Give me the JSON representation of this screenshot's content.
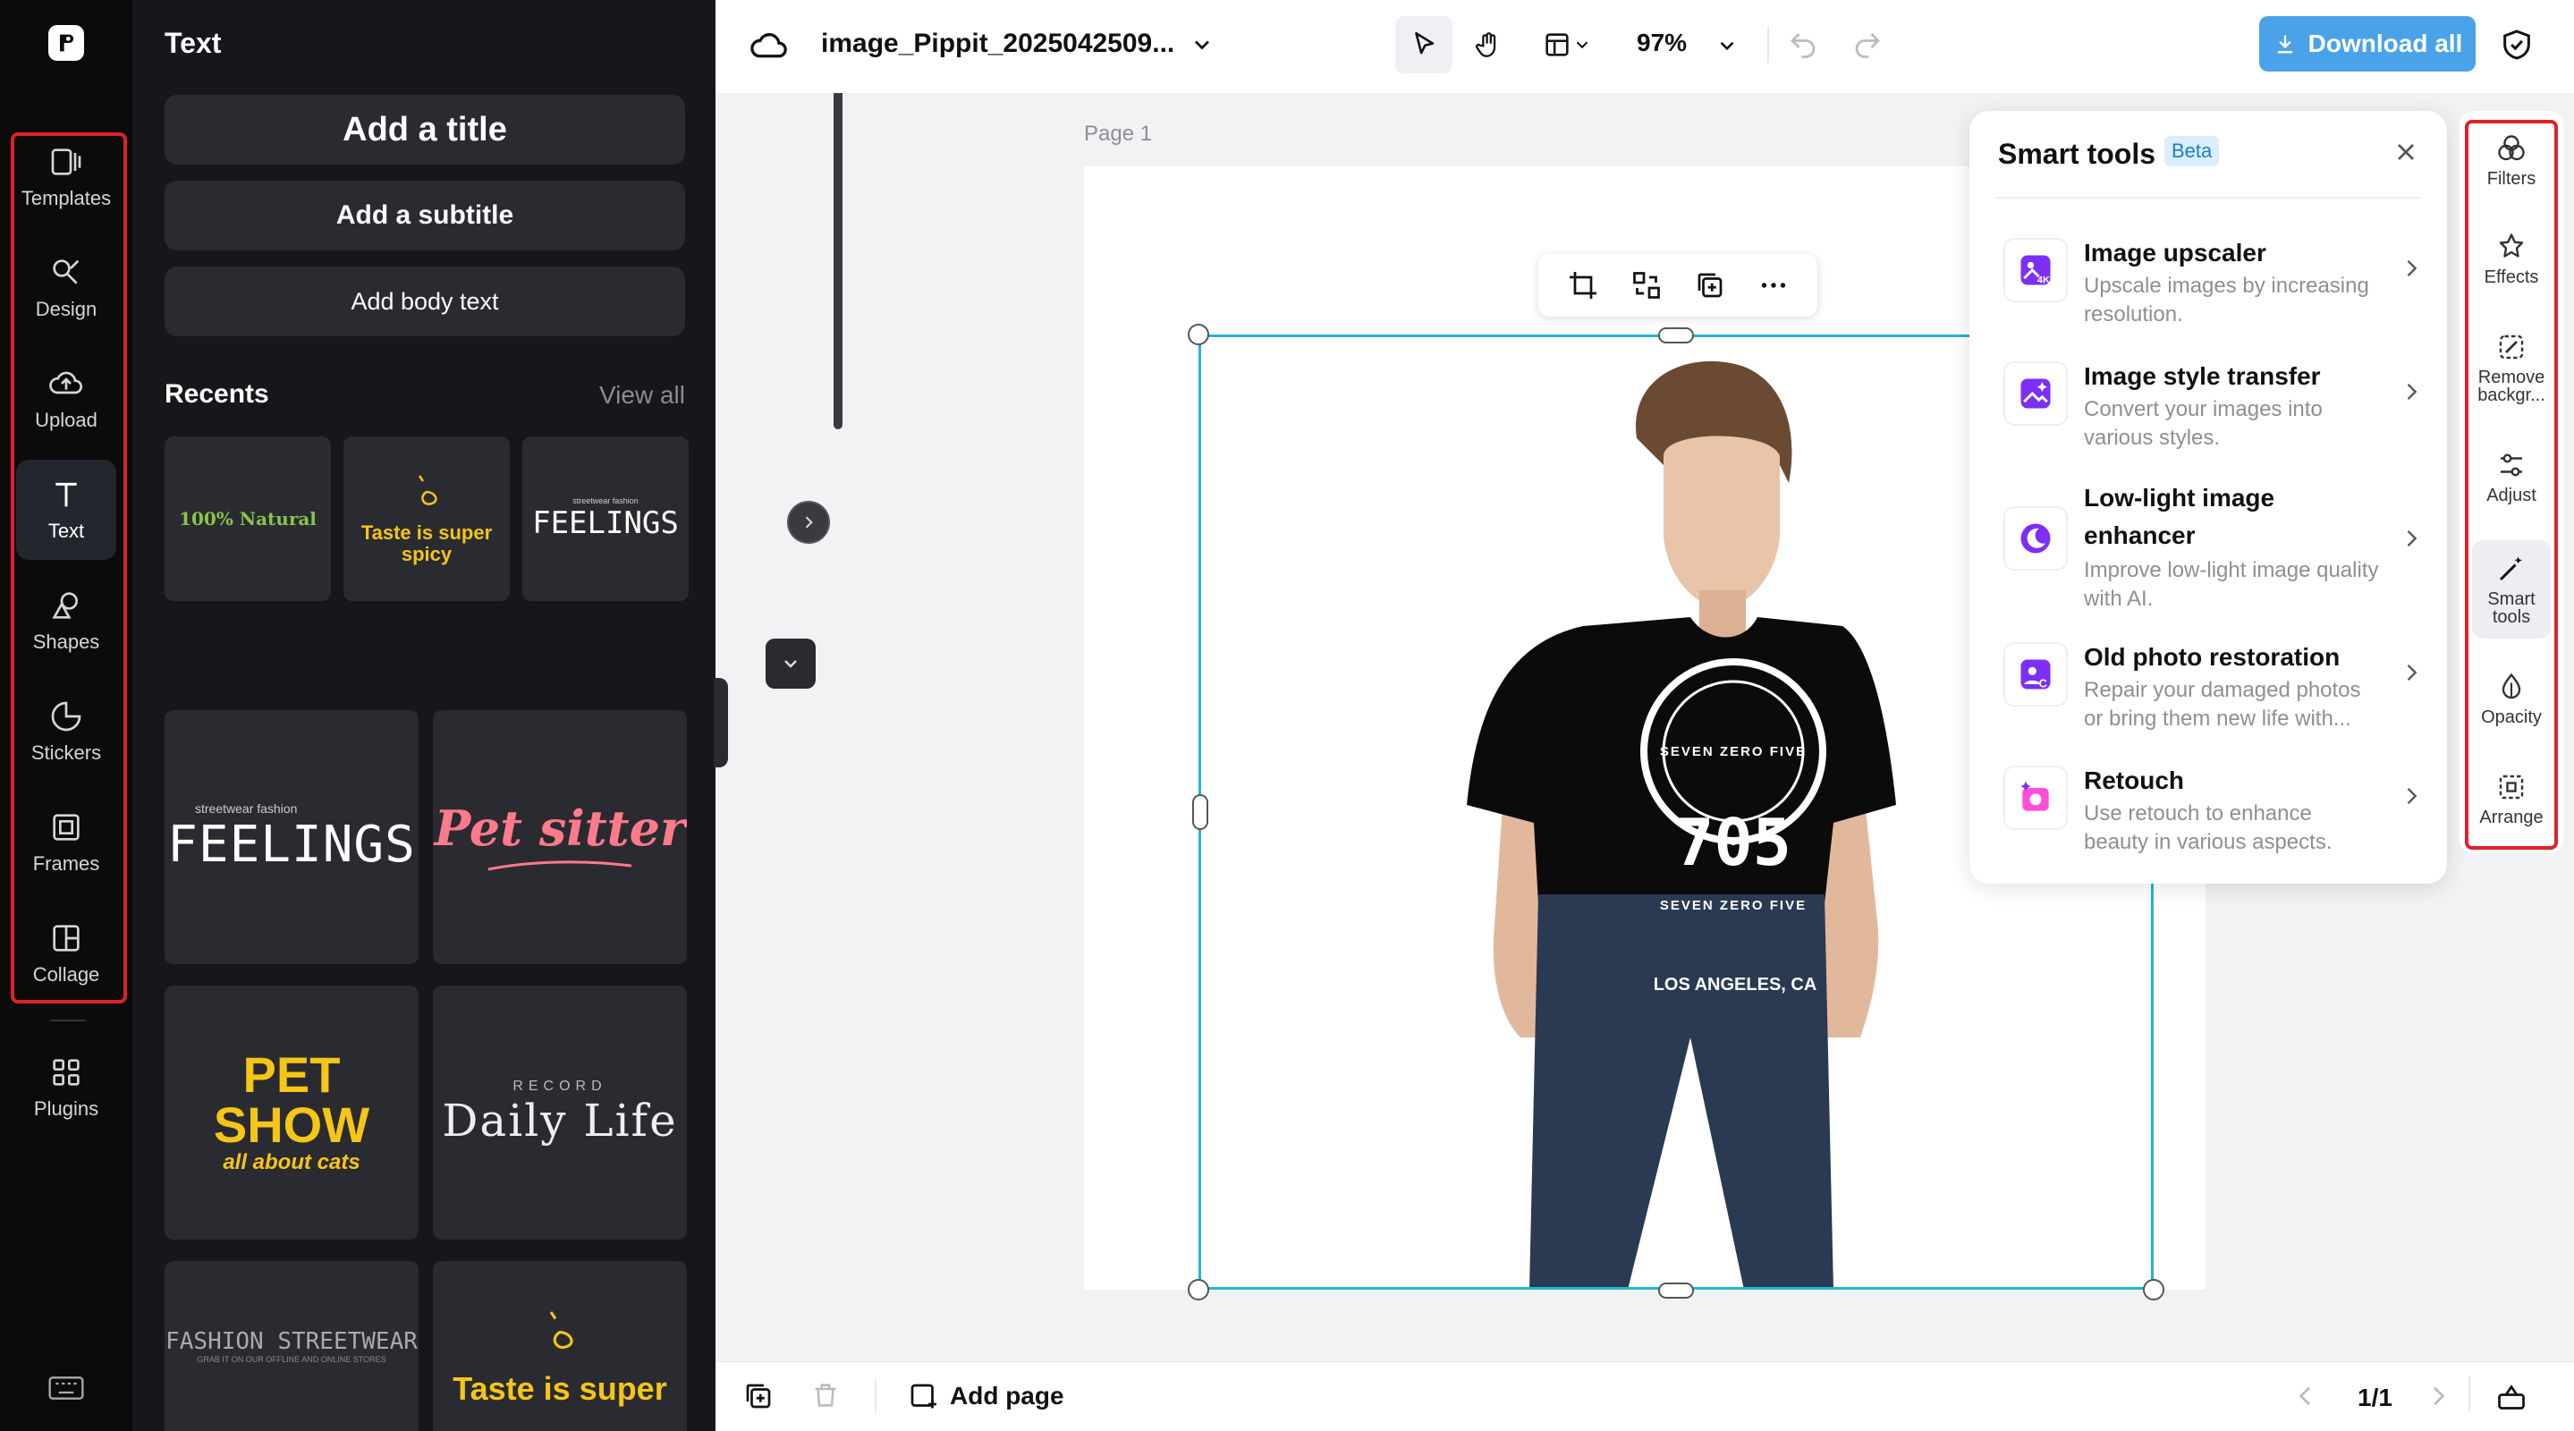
{
  "rail": {
    "items": [
      {
        "label": "Templates",
        "icon": "templates-icon"
      },
      {
        "label": "Design",
        "icon": "design-icon"
      },
      {
        "label": "Upload",
        "icon": "upload-icon"
      },
      {
        "label": "Text",
        "icon": "text-icon",
        "active": true
      },
      {
        "label": "Shapes",
        "icon": "shapes-icon"
      },
      {
        "label": "Stickers",
        "icon": "stickers-icon"
      },
      {
        "label": "Frames",
        "icon": "frames-icon"
      },
      {
        "label": "Collage",
        "icon": "collage-icon"
      },
      {
        "label": "Plugins",
        "icon": "plugins-icon"
      }
    ]
  },
  "panel": {
    "title": "Text",
    "buttons": {
      "title": "Add a title",
      "subtitle": "Add a subtitle",
      "body": "Add body text"
    },
    "recents_label": "Recents",
    "view_all": "View all",
    "recents": [
      "100% Natural",
      "Taste is super spicy",
      "FEELINGS"
    ],
    "recent_small": "streetwear fashion",
    "grid": [
      {
        "small": "streetwear fashion",
        "main": "FEELINGS"
      },
      {
        "main": "Pet sitter"
      },
      {
        "main": "PET SHOW",
        "sub": "all about cats"
      },
      {
        "small": "RECORD",
        "main": "Daily Life"
      },
      {
        "main": "FASHION STREETWEAR",
        "sub": "GRAB IT ON OUR OFFLINE AND ONLINE STORES"
      },
      {
        "main": "Taste is super"
      }
    ]
  },
  "topbar": {
    "filename": "image_Pippit_2025042509...",
    "zoom": "97%",
    "download": "Download all"
  },
  "canvas": {
    "page_label": "Page 1",
    "shirt_top": "SEVEN ZERO FIVE",
    "shirt_number": "705",
    "shirt_bottom": "SEVEN ZERO FIVE",
    "shirt_city": "LOS ANGELES, CA"
  },
  "smart_tools": {
    "title": "Smart tools",
    "badge": "Beta",
    "items": [
      {
        "name": "Image upscaler",
        "desc": "Upscale images by increasing resolution.",
        "icon": "upscaler-icon"
      },
      {
        "name": "Image style transfer",
        "desc": "Convert your images into various styles.",
        "icon": "style-transfer-icon"
      },
      {
        "name": "Low-light image enhancer",
        "desc": "Improve low-light image quality with AI.",
        "icon": "low-light-icon"
      },
      {
        "name": "Old photo restoration",
        "desc": "Repair your damaged photos or bring them new life with...",
        "icon": "restoration-icon"
      },
      {
        "name": "Retouch",
        "desc": "Use retouch to enhance beauty in various aspects.",
        "icon": "retouch-icon"
      }
    ]
  },
  "right_rail": {
    "items": [
      {
        "label": "Filters"
      },
      {
        "label": "Effects"
      },
      {
        "label": "Remove backgr..."
      },
      {
        "label": "Adjust"
      },
      {
        "label": "Smart tools",
        "active": true
      },
      {
        "label": "Opacity"
      },
      {
        "label": "Arrange"
      }
    ]
  },
  "bottombar": {
    "add_page": "Add page",
    "page_count": "1/1"
  },
  "colors": {
    "accent": "#4aa3e8",
    "highlight": "#e0202a",
    "selection": "#1fb8d4",
    "smart_icon": "#7b2ff7"
  }
}
